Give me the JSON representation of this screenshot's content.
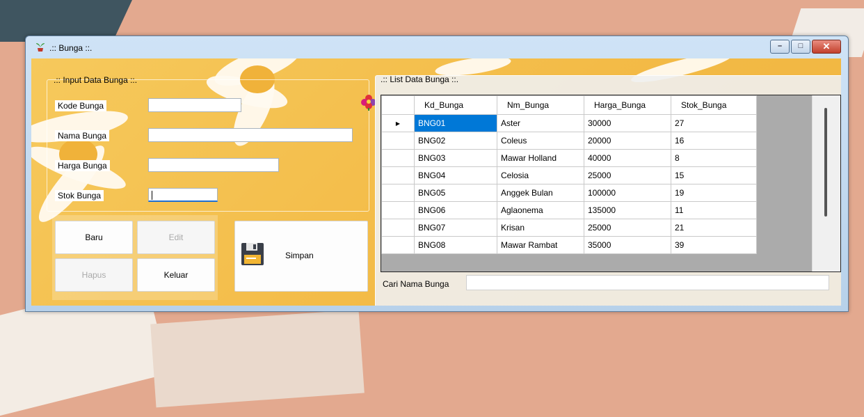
{
  "window": {
    "title": ".:: Bunga ::.",
    "minimize_glyph": "–",
    "maximize_glyph": "□",
    "close_glyph": "✕"
  },
  "input_group": {
    "legend": ".:: Input Data Bunga ::.",
    "fields": {
      "kode": {
        "label": "Kode Bunga",
        "value": ""
      },
      "nama": {
        "label": "Nama Bunga",
        "value": ""
      },
      "harga": {
        "label": "Harga Bunga",
        "value": ""
      },
      "stok": {
        "label": "Stok Bunga",
        "value": ""
      }
    }
  },
  "buttons": {
    "baru": "Baru",
    "edit": "Edit",
    "hapus": "Hapus",
    "keluar": "Keluar",
    "simpan": "Simpan"
  },
  "list_group": {
    "legend": ".:: List Data Bunga ::.",
    "columns": [
      "Kd_Bunga",
      "Nm_Bunga",
      "Harga_Bunga",
      "Stok_Bunga"
    ],
    "row_indicator": "▶",
    "rows": [
      [
        "BNG01",
        "Aster",
        "30000",
        "27"
      ],
      [
        "BNG02",
        "Coleus",
        "20000",
        "16"
      ],
      [
        "BNG03",
        "Mawar Holland",
        "40000",
        "8"
      ],
      [
        "BNG04",
        "Celosia",
        "25000",
        "15"
      ],
      [
        "BNG05",
        "Anggek Bulan",
        "100000",
        "19"
      ],
      [
        "BNG06",
        "Aglaonema",
        "135000",
        "11"
      ],
      [
        "BNG07",
        "Krisan",
        "25000",
        "21"
      ],
      [
        "BNG08",
        "Mawar Rambat",
        "35000",
        "39"
      ]
    ]
  },
  "search": {
    "label": "Cari Nama Bunga",
    "value": ""
  },
  "colors": {
    "form_background": "#f3bb47",
    "selection": "#0078d7"
  }
}
